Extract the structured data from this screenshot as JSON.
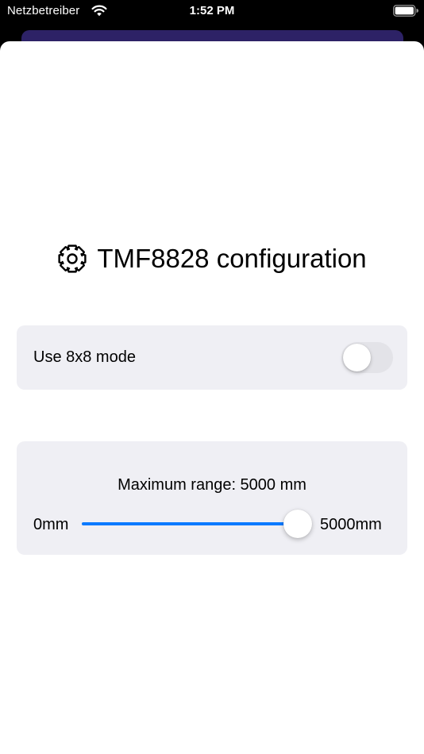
{
  "status_bar": {
    "carrier": "Netzbetreiber",
    "time": "1:52 PM",
    "wifi_icon": "wifi-icon",
    "battery_icon": "battery-icon"
  },
  "config": {
    "title_icon": "gear-icon",
    "title": "TMF8828 configuration"
  },
  "mode_toggle": {
    "label": "Use 8x8 mode",
    "on": false
  },
  "range": {
    "label": "Maximum range: 5000 mm",
    "min_label": "0mm",
    "max_label": "5000mm",
    "min": 0,
    "max": 5000,
    "value": 5000
  },
  "colors": {
    "accent": "#0a7aff",
    "card_background": "#efeff4",
    "switch_off": "#e3e3e8",
    "behind_sheet": "#2d2266"
  }
}
